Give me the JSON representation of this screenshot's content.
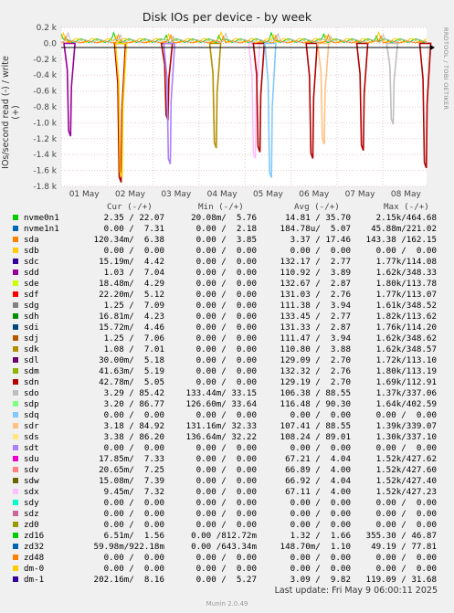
{
  "chart_data": {
    "type": "area",
    "title": "Disk IOs per device - by week",
    "ylabel": "IOs/second read (-) / write (+)",
    "side_label": "RRDTOOL / TOBI OETIKER",
    "ylim": [
      -1.8,
      0.2
    ],
    "yticks": [
      0.2,
      0.0,
      -0.2,
      -0.4,
      -0.6,
      -0.8,
      -1.0,
      -1.2,
      -1.4,
      -1.6,
      -1.8
    ],
    "ytick_labels": [
      "0.2 k",
      "0.0",
      "-0.2 k",
      "-0.4 k",
      "-0.6 k",
      "-0.8 k",
      "-1.0 k",
      "-1.2 k",
      "-1.4 k",
      "-1.6 k",
      "-1.8 k"
    ],
    "xticks": [
      "01 May",
      "02 May",
      "03 May",
      "04 May",
      "05 May",
      "06 May",
      "07 May",
      "08 May"
    ],
    "grid": true,
    "read_spikes": [
      {
        "day": 0.18,
        "value": -1.1,
        "series": "sdd"
      },
      {
        "day": 1.28,
        "value": -1.68,
        "series": "sdn"
      },
      {
        "day": 1.3,
        "value": -1.62,
        "series": "sdb"
      },
      {
        "day": 2.3,
        "value": -0.9,
        "series": "sdn"
      },
      {
        "day": 2.35,
        "value": -1.45,
        "series": "sdt"
      },
      {
        "day": 3.35,
        "value": -1.25,
        "series": "sdk"
      },
      {
        "day": 4.2,
        "value": -1.38,
        "series": "sdx"
      },
      {
        "day": 4.3,
        "value": -1.3,
        "series": "sdn"
      },
      {
        "day": 4.55,
        "value": -1.62,
        "series": "sdq"
      },
      {
        "day": 5.45,
        "value": -1.38,
        "series": "sdn"
      },
      {
        "day": 5.7,
        "value": -1.2,
        "series": "sdr"
      },
      {
        "day": 6.55,
        "value": -1.28,
        "series": "sdn"
      },
      {
        "day": 7.2,
        "value": -0.95,
        "series": "sdo"
      },
      {
        "day": 7.92,
        "value": -1.5,
        "series": "sdn"
      }
    ],
    "columns": [
      "Cur (-/+)",
      "Min (-/+)",
      "Avg (-/+)",
      "Max (-/+)"
    ],
    "series": [
      {
        "name": "nvme0n1",
        "color": "#00cc00",
        "cur": " 2.35 / 22.07",
        "min": "20.08m/  5.76",
        "avg": "14.81 / 35.70",
        "max": "2.15k/464.68"
      },
      {
        "name": "nvme1n1",
        "color": "#0066b3",
        "cur": " 0.00 /  7.31",
        "min": " 0.00 /  2.18",
        "avg": "184.78u/  5.07",
        "max": "45.88m/221.02"
      },
      {
        "name": "sda",
        "color": "#ff8000",
        "cur": "120.34m/  6.38",
        "min": " 0.00 /  3.85",
        "avg": " 3.37 / 17.46",
        "max": "143.38 /162.15"
      },
      {
        "name": "sdb",
        "color": "#ffcc00",
        "cur": " 0.00 /  0.00",
        "min": " 0.00 /  0.00",
        "avg": " 0.00 /  0.00",
        "max": " 0.00 /  0.00"
      },
      {
        "name": "sdc",
        "color": "#330099",
        "cur": "15.19m/  4.42",
        "min": " 0.00 /  0.00",
        "avg": "132.17 /  2.77",
        "max": "1.77k/114.08"
      },
      {
        "name": "sdd",
        "color": "#990099",
        "cur": " 1.03 /  7.04",
        "min": " 0.00 /  0.00",
        "avg": "110.92 /  3.89",
        "max": "1.62k/348.33"
      },
      {
        "name": "sde",
        "color": "#ccff00",
        "cur": "18.48m/  4.29",
        "min": " 0.00 /  0.00",
        "avg": "132.67 /  2.87",
        "max": "1.80k/113.78"
      },
      {
        "name": "sdf",
        "color": "#ff0000",
        "cur": "22.20m/  5.12",
        "min": " 0.00 /  0.00",
        "avg": "131.03 /  2.76",
        "max": "1.77k/113.07"
      },
      {
        "name": "sdg",
        "color": "#808080",
        "cur": " 1.25 /  7.09",
        "min": " 0.00 /  0.00",
        "avg": "111.38 /  3.94",
        "max": "1.61k/348.52"
      },
      {
        "name": "sdh",
        "color": "#008f00",
        "cur": "16.81m/  4.23",
        "min": " 0.00 /  0.00",
        "avg": "133.45 /  2.77",
        "max": "1.82k/113.62"
      },
      {
        "name": "sdi",
        "color": "#00487d",
        "cur": "15.72m/  4.46",
        "min": " 0.00 /  0.00",
        "avg": "131.33 /  2.87",
        "max": "1.76k/114.20"
      },
      {
        "name": "sdj",
        "color": "#b35a00",
        "cur": " 1.25 /  7.06",
        "min": " 0.00 /  0.00",
        "avg": "111.47 /  3.94",
        "max": "1.62k/348.62"
      },
      {
        "name": "sdk",
        "color": "#b38f00",
        "cur": " 1.08 /  7.01",
        "min": " 0.00 /  0.00",
        "avg": "110.80 /  3.88",
        "max": "1.62k/348.57"
      },
      {
        "name": "sdl",
        "color": "#6b006b",
        "cur": "30.00m/  5.18",
        "min": " 0.00 /  0.00",
        "avg": "129.09 /  2.70",
        "max": "1.72k/113.10"
      },
      {
        "name": "sdm",
        "color": "#8fb300",
        "cur": "41.63m/  5.19",
        "min": " 0.00 /  0.00",
        "avg": "132.32 /  2.76",
        "max": "1.80k/113.19"
      },
      {
        "name": "sdn",
        "color": "#b30000",
        "cur": "42.78m/  5.05",
        "min": " 0.00 /  0.00",
        "avg": "129.19 /  2.70",
        "max": "1.69k/112.91"
      },
      {
        "name": "sdo",
        "color": "#bebebe",
        "cur": " 3.29 / 85.42",
        "min": "133.44m/ 33.15",
        "avg": "106.38 / 88.55",
        "max": "1.37k/337.06"
      },
      {
        "name": "sdp",
        "color": "#80ff80",
        "cur": " 3.20 / 86.77",
        "min": "126.60m/ 33.64",
        "avg": "116.48 / 90.30",
        "max": "1.64k/402.59"
      },
      {
        "name": "sdq",
        "color": "#80c9ff",
        "cur": " 0.00 /  0.00",
        "min": " 0.00 /  0.00",
        "avg": " 0.00 /  0.00",
        "max": " 0.00 /  0.00"
      },
      {
        "name": "sdr",
        "color": "#ffc080",
        "cur": " 3.18 / 84.92",
        "min": "131.16m/ 32.33",
        "avg": "107.41 / 88.55",
        "max": "1.39k/339.07"
      },
      {
        "name": "sds",
        "color": "#ffe680",
        "cur": " 3.38 / 86.20",
        "min": "136.64m/ 32.22",
        "avg": "108.24 / 89.01",
        "max": "1.30k/337.10"
      },
      {
        "name": "sdt",
        "color": "#aa80ff",
        "cur": " 0.00 /  0.00",
        "min": " 0.00 /  0.00",
        "avg": " 0.00 /  0.00",
        "max": " 0.00 /  0.00"
      },
      {
        "name": "sdu",
        "color": "#ee00cc",
        "cur": "17.85m/  7.33",
        "min": " 0.00 /  0.00",
        "avg": "67.21 /  4.04",
        "max": "1.52k/427.62"
      },
      {
        "name": "sdv",
        "color": "#ff8080",
        "cur": "20.65m/  7.25",
        "min": " 0.00 /  0.00",
        "avg": "66.89 /  4.00",
        "max": "1.52k/427.60"
      },
      {
        "name": "sdw",
        "color": "#666600",
        "cur": "15.08m/  7.39",
        "min": " 0.00 /  0.00",
        "avg": "66.92 /  4.04",
        "max": "1.52k/427.40"
      },
      {
        "name": "sdx",
        "color": "#ffbfff",
        "cur": " 9.45m/  7.32",
        "min": " 0.00 /  0.00",
        "avg": "67.11 /  4.00",
        "max": "1.52k/427.23"
      },
      {
        "name": "sdy",
        "color": "#00ffcc",
        "cur": " 0.00 /  0.00",
        "min": " 0.00 /  0.00",
        "avg": " 0.00 /  0.00",
        "max": " 0.00 /  0.00"
      },
      {
        "name": "sdz",
        "color": "#cc6699",
        "cur": " 0.00 /  0.00",
        "min": " 0.00 /  0.00",
        "avg": " 0.00 /  0.00",
        "max": " 0.00 /  0.00"
      },
      {
        "name": "zd0",
        "color": "#999900",
        "cur": " 0.00 /  0.00",
        "min": " 0.00 /  0.00",
        "avg": " 0.00 /  0.00",
        "max": " 0.00 /  0.00"
      },
      {
        "name": "zd16",
        "color": "#00cc00",
        "cur": " 6.51m/  1.56",
        "min": " 0.00 /812.72m",
        "avg": " 1.32 /  1.66",
        "max": "355.30 / 46.87"
      },
      {
        "name": "zd32",
        "color": "#0066b3",
        "cur": "59.98m/922.18m",
        "min": " 0.00 /643.34m",
        "avg": "148.70m/  1.10",
        "max": "49.19 / 77.81"
      },
      {
        "name": "zd48",
        "color": "#ff8000",
        "cur": " 0.00 /  0.00",
        "min": " 0.00 /  0.00",
        "avg": " 0.00 /  0.00",
        "max": " 0.00 /  0.00"
      },
      {
        "name": "dm-0",
        "color": "#ffcc00",
        "cur": " 0.00 /  0.00",
        "min": " 0.00 /  0.00",
        "avg": " 0.00 /  0.00",
        "max": " 0.00 /  0.00"
      },
      {
        "name": "dm-1",
        "color": "#330099",
        "cur": "202.16m/  8.16",
        "min": " 0.00 /  5.27",
        "avg": " 3.09 /  9.82",
        "max": "119.09 / 31.68"
      }
    ]
  },
  "footer": {
    "last_update": "Last update:  Fri May  9 06:00:11 2025",
    "munin": "Munin 2.0.49"
  }
}
